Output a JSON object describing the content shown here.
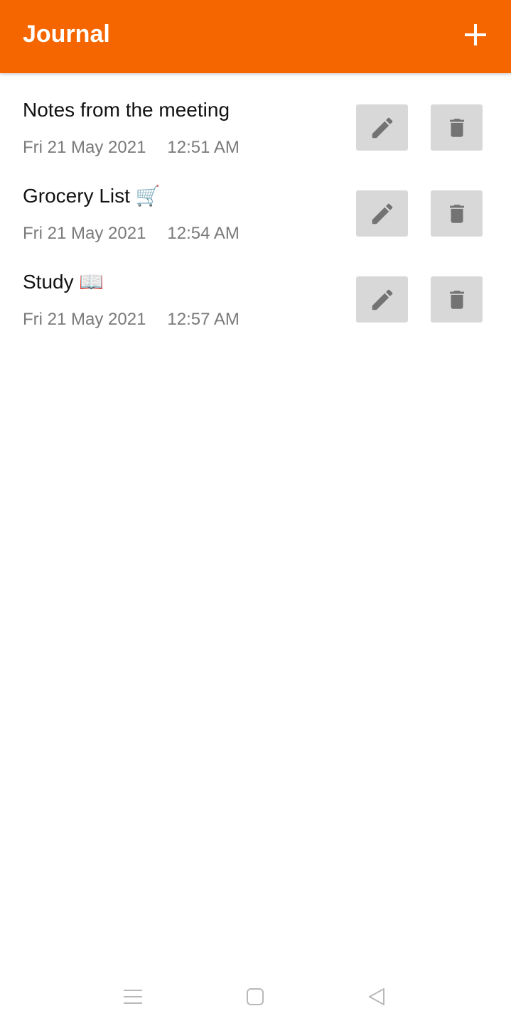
{
  "colors": {
    "appbar": "#F56600",
    "button_bg": "#D8D8D8",
    "icon": "#737373",
    "meta_text": "#7A7A7A"
  },
  "header": {
    "title": "Journal",
    "add_icon": "plus-icon"
  },
  "entries": [
    {
      "title": "Notes from the meeting",
      "date": "Fri 21 May 2021",
      "time": "12:51 AM"
    },
    {
      "title": "Grocery List 🛒",
      "date": "Fri 21 May 2021",
      "time": "12:54 AM"
    },
    {
      "title": "Study 📖",
      "date": "Fri 21 May 2021",
      "time": "12:57 AM"
    }
  ],
  "row_icons": {
    "edit": "pencil-icon",
    "delete": "trash-icon"
  },
  "system_nav": {
    "menu": "menu-icon",
    "home": "home-icon",
    "back": "back-icon"
  }
}
